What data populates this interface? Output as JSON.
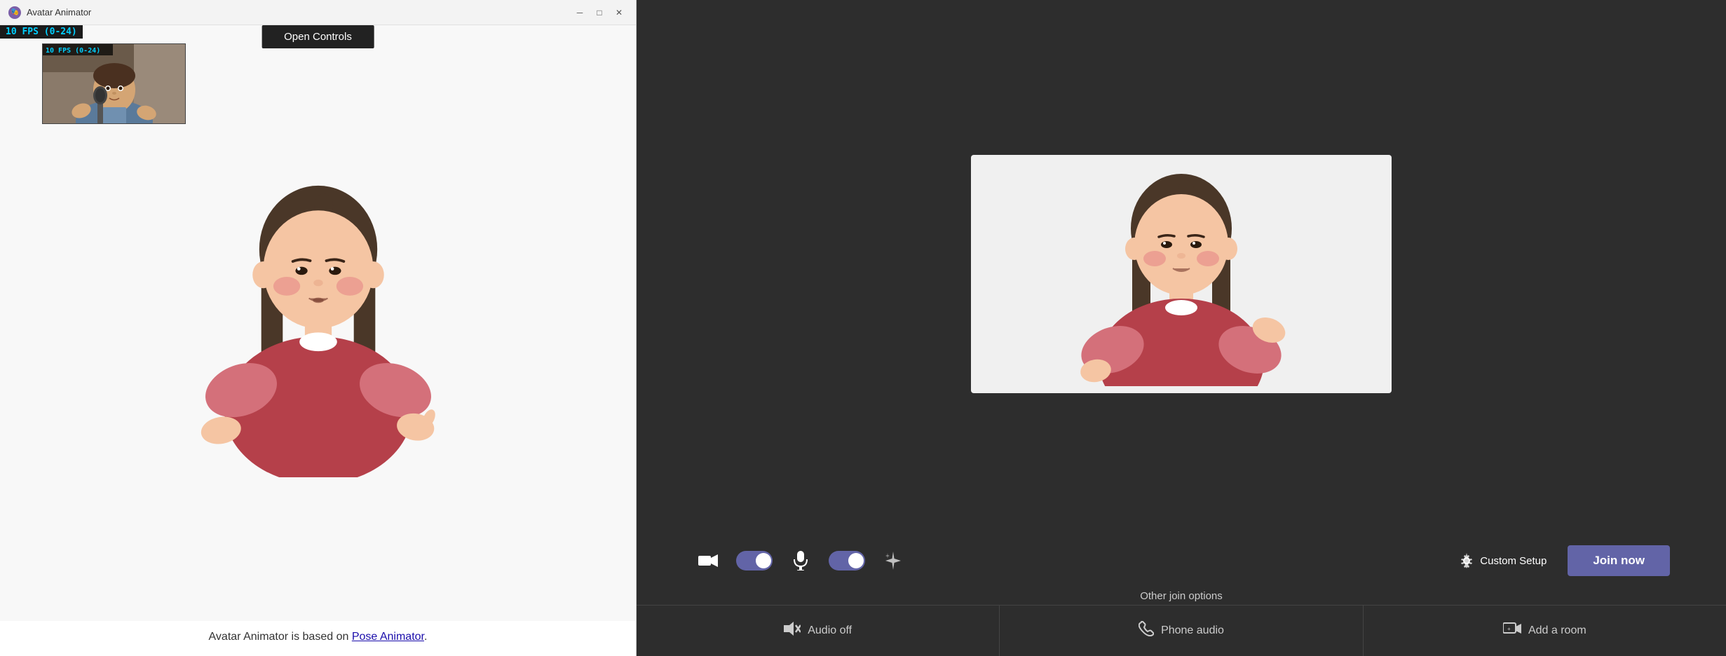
{
  "window": {
    "title": "Avatar Animator",
    "icon": "🎭"
  },
  "window_controls": {
    "minimize": "─",
    "maximize": "□",
    "close": "✕"
  },
  "fps_badge": "10 FPS (0-24)",
  "open_controls_label": "Open Controls",
  "footer": {
    "text_before": "Avatar Animator is based on ",
    "link_text": "Pose Animator",
    "text_after": "."
  },
  "teams": {
    "controls": {
      "camera_toggle_on": true,
      "mic_toggle_on": true,
      "blur_icon": "✦",
      "gear_icon": "⚙",
      "custom_setup_label": "Custom Setup",
      "join_now_label": "Join now"
    },
    "other_join_label": "Other join options",
    "bottom_options": [
      {
        "icon": "🔇",
        "label": "Audio off"
      },
      {
        "icon": "📞",
        "label": "Phone audio"
      },
      {
        "icon": "📺",
        "label": "Add a room"
      }
    ]
  }
}
